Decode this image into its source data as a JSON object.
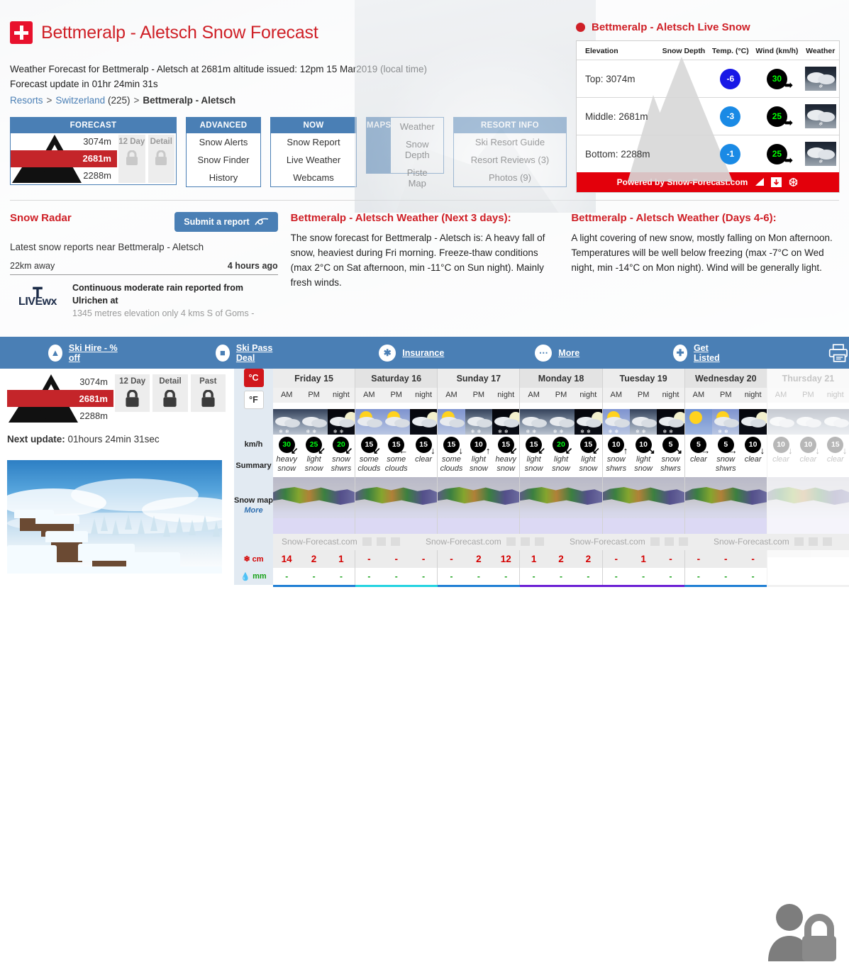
{
  "header": {
    "flag_icon": "swiss-flag-icon",
    "title": "Bettmeralp - Aletsch Snow Forecast",
    "intro_line1": "Weather Forecast for Bettmeralp - Aletsch at 2681m altitude issued: 12pm 15 Mar2019 (local time)",
    "intro_line2": "Forecast update in 01hr 24min 31s",
    "breadcrumb": {
      "resorts": "Resorts",
      "country": "Switzerland",
      "count": "(225)",
      "current": "Bettmeralp - Aletsch",
      "sep": ">"
    }
  },
  "navcards": {
    "forecast": {
      "title": "FORECAST",
      "elevations": [
        "3074m",
        "2681m",
        "2288m"
      ],
      "locks": [
        {
          "label": "12 Day",
          "icon": "lock-icon"
        },
        {
          "label": "Detail",
          "icon": "lock-icon"
        }
      ]
    },
    "advanced": {
      "title": "ADVANCED",
      "items": [
        "Snow Alerts",
        "Snow Finder",
        "History"
      ]
    },
    "now": {
      "title": "NOW",
      "items": [
        "Snow Report",
        "Live Weather",
        "Webcams"
      ]
    },
    "maps": {
      "title": "MAPS",
      "items": [
        "Weather",
        "Snow Depth",
        "Piste Map"
      ]
    },
    "resort_info": {
      "title": "RESORT INFO",
      "items": [
        "Ski Resort Guide",
        "Resort Reviews (3)",
        "Photos (9)"
      ]
    }
  },
  "live_snow": {
    "title": "Bettmeralp - Aletsch Live Snow",
    "columns": [
      "Elevation",
      "Snow Depth",
      "Temp. (°C)",
      "Wind (km/h)",
      "Weather"
    ],
    "rows": [
      {
        "elevation": "Top: 3074m",
        "snow_depth": "",
        "temp": "-6",
        "temp_color": "#1818e6",
        "wind": "30",
        "weather_icon": "cloud-snow-night-icon"
      },
      {
        "elevation": "Middle: 2681m",
        "snow_depth": "",
        "temp": "-3",
        "temp_color": "#1a8ae5",
        "wind": "25",
        "weather_icon": "cloud-snow-night-icon"
      },
      {
        "elevation": "Bottom: 2288m",
        "snow_depth": "",
        "temp": "-1",
        "temp_color": "#1a8ae5",
        "wind": "25",
        "weather_icon": "cloud-snow-night-icon"
      }
    ],
    "powered_by": "Powered by Snow-Forecast.com",
    "powered_icons": [
      "resize-icon",
      "download-icon",
      "share-icon"
    ],
    "bar_color": "#e3000b"
  },
  "snow_radar": {
    "title": "Snow Radar",
    "submit_button": "Submit a report",
    "submit_icon": "eye-icon",
    "subtitle": "Latest snow reports near Bettmeralp - Aletsch",
    "distance": "22km away",
    "age": "4 hours ago",
    "logo_text": "LIVE",
    "logo_text2": "wx",
    "report_line1": "Continuous moderate rain reported from Ulrichen at",
    "report_line2": "1345 metres elevation only 4 kms S of Goms -"
  },
  "weather_next3": {
    "title": "Bettmeralp - Aletsch Weather (Next 3 days):",
    "body": "The snow forecast for Bettmeralp - Aletsch is: A heavy fall of snow, heaviest during Fri morning. Freeze-thaw conditions (max 2°C on Sat afternoon, min -11°C on Sun night). Mainly fresh winds."
  },
  "weather_days46": {
    "title": "Bettmeralp - Aletsch Weather (Days 4-6):",
    "body": "A light covering of new snow, mostly falling on Mon afternoon. Temperatures will be well below freezing (max -7°C on Wed night, min -14°C on Mon night). Wind will be generally light."
  },
  "bluebar": {
    "color": "#4a7fb5",
    "items": [
      {
        "label": "Ski Hire - % off",
        "icon": "ski-hire-icon"
      },
      {
        "label": "Ski Pass Deal",
        "icon": "gondola-icon"
      },
      {
        "label": "Insurance",
        "icon": "asterisk-icon"
      },
      {
        "label": "More",
        "icon": "ellipsis-icon"
      },
      {
        "label": "Get Listed",
        "icon": "plus-icon"
      }
    ],
    "print_icon": "printer-icon"
  },
  "left_pane": {
    "elevations": [
      "3074m",
      "2681m",
      "2288m"
    ],
    "tabs": [
      {
        "label": "12 Day",
        "icon": "lock-icon"
      },
      {
        "label": "Detail",
        "icon": "lock-icon"
      },
      {
        "label": "Past",
        "icon": "lock-icon"
      }
    ],
    "next_update_label": "Next update:",
    "next_update_value": "01hours 24min 31sec",
    "photo_alt": "snow-covered-chalets-photo"
  },
  "forecast_table": {
    "unit_temp_selected": "°C",
    "unit_temp_other": "°F",
    "row_labels": {
      "wind": "km/h",
      "summary": "Summary",
      "snow_map": "Snow map",
      "snow_map_more": "More",
      "snow": "cm",
      "rain": "mm",
      "snow_icon": "snowflake-icon",
      "rain_icon": "raindrop-icon"
    },
    "brand": "Snow-Forecast.com",
    "brand_icons": [
      "resize-icon",
      "download-icon",
      "share-icon"
    ],
    "periods": [
      "AM",
      "PM",
      "night"
    ],
    "days": [
      {
        "name": "Friday 15",
        "ghost": false,
        "underline": "#1f7fd4",
        "icons": [
          "cloud-snow-day-icon",
          "cloud-snow-day-icon",
          "moon-snow-icon"
        ],
        "winds": [
          {
            "v": "30",
            "dir": "se",
            "green": true
          },
          {
            "v": "25",
            "dir": "se",
            "green": true
          },
          {
            "v": "20",
            "dir": "se",
            "green": true
          }
        ],
        "summary": [
          "heavy snow",
          "light snow",
          "snow shwrs"
        ],
        "snow": [
          "14",
          "2",
          "1"
        ],
        "rain": [
          "-",
          "-",
          "-"
        ]
      },
      {
        "name": "Saturday 16",
        "ghost": false,
        "underline": "#23d3e0",
        "icons": [
          "sun-cloud-icon",
          "sun-cloud-icon",
          "moon-clear-icon"
        ],
        "winds": [
          {
            "v": "15",
            "dir": "se",
            "green": false
          },
          {
            "v": "15",
            "dir": "e",
            "green": false
          },
          {
            "v": "15",
            "dir": "n",
            "green": false
          }
        ],
        "summary": [
          "some clouds",
          "some clouds",
          "clear"
        ],
        "snow": [
          "-",
          "-",
          "-"
        ],
        "rain": [
          "-",
          "-",
          "-"
        ]
      },
      {
        "name": "Sunday 17",
        "ghost": false,
        "underline": "#1f7fd4",
        "icons": [
          "sun-cloud-icon",
          "cloud-snow-icon",
          "moon-snow-icon"
        ],
        "winds": [
          {
            "v": "15",
            "dir": "n",
            "green": false
          },
          {
            "v": "10",
            "dir": "s",
            "green": false
          },
          {
            "v": "15",
            "dir": "se",
            "green": false
          }
        ],
        "summary": [
          "some clouds",
          "light snow",
          "heavy snow"
        ],
        "snow": [
          "-",
          "2",
          "12"
        ],
        "rain": [
          "-",
          "-",
          "-"
        ]
      },
      {
        "name": "Monday 18",
        "ghost": false,
        "underline": "#6a1fd4",
        "icons": [
          "cloud-snow-icon",
          "cloud-snow-icon",
          "moon-cloud-snow-icon"
        ],
        "winds": [
          {
            "v": "15",
            "dir": "se",
            "green": false
          },
          {
            "v": "20",
            "dir": "se",
            "green": true
          },
          {
            "v": "15",
            "dir": "se",
            "green": false
          }
        ],
        "summary": [
          "light snow",
          "light snow",
          "light snow"
        ],
        "snow": [
          "1",
          "2",
          "2"
        ],
        "rain": [
          "-",
          "-",
          "-"
        ]
      },
      {
        "name": "Tuesday 19",
        "ghost": false,
        "underline": "#6a1fd4",
        "icons": [
          "sun-cloud-snow-icon",
          "cloud-snow-icon",
          "moon-cloud-snow-icon"
        ],
        "winds": [
          {
            "v": "10",
            "dir": "s",
            "green": false
          },
          {
            "v": "10",
            "dir": "sw",
            "green": false
          },
          {
            "v": "5",
            "dir": "sw",
            "green": false
          }
        ],
        "summary": [
          "snow shwrs",
          "light snow",
          "snow shwrs"
        ],
        "snow": [
          "-",
          "1",
          "-"
        ],
        "rain": [
          "-",
          "-",
          "-"
        ]
      },
      {
        "name": "Wednesday 20",
        "ghost": false,
        "underline": "#1f7fd4",
        "icons": [
          "sun-icon",
          "sun-cloud-snow-icon",
          "moon-clear-icon"
        ],
        "winds": [
          {
            "v": "5",
            "dir": "w",
            "green": false
          },
          {
            "v": "5",
            "dir": "w",
            "green": false
          },
          {
            "v": "10",
            "dir": "n",
            "green": false
          }
        ],
        "summary": [
          "clear",
          "snow shwrs",
          "clear"
        ],
        "snow": [
          "-",
          "-",
          "-"
        ],
        "rain": [
          "-",
          "-",
          "-"
        ]
      },
      {
        "name": "Thursday 21",
        "ghost": true,
        "underline": "#cccccc",
        "icons": [
          "locked-icon",
          "locked-icon",
          "locked-icon"
        ],
        "winds": [
          {
            "v": "10",
            "dir": "n",
            "green": false
          },
          {
            "v": "10",
            "dir": "n",
            "green": false
          },
          {
            "v": "15",
            "dir": "n",
            "green": false
          }
        ],
        "summary": [
          "clear",
          "clear",
          "clear"
        ],
        "snow": [
          "",
          "",
          ""
        ],
        "rain": [
          "",
          "",
          ""
        ]
      }
    ]
  },
  "paywall": {
    "icon": "person-lock-icon"
  }
}
